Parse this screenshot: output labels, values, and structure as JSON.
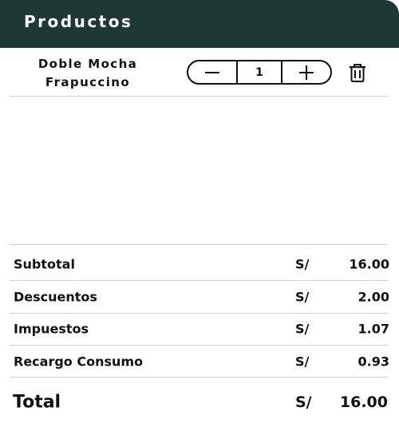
{
  "header": {
    "title": "Productos"
  },
  "product": {
    "name_line1": "Doble Mocha",
    "name_line2": "Frapuccino",
    "quantity": "1",
    "decrement_icon": "minus-icon",
    "increment_icon": "plus-icon",
    "delete_icon": "trash-icon"
  },
  "summary": {
    "rows": [
      {
        "label": "Subtotal",
        "currency": "S/",
        "amount": "16.00"
      },
      {
        "label": "Descuentos",
        "currency": "S/",
        "amount": "2.00"
      },
      {
        "label": "Impuestos",
        "currency": "S/",
        "amount": "1.07"
      },
      {
        "label": "Recargo Consumo",
        "currency": "S/",
        "amount": "0.93"
      }
    ],
    "total": {
      "label": "Total",
      "currency": "S/",
      "amount": "16.00"
    }
  },
  "colors": {
    "header_bg": "#1e3932",
    "header_text": "#ffffff",
    "divider": "#cfcfcf"
  }
}
